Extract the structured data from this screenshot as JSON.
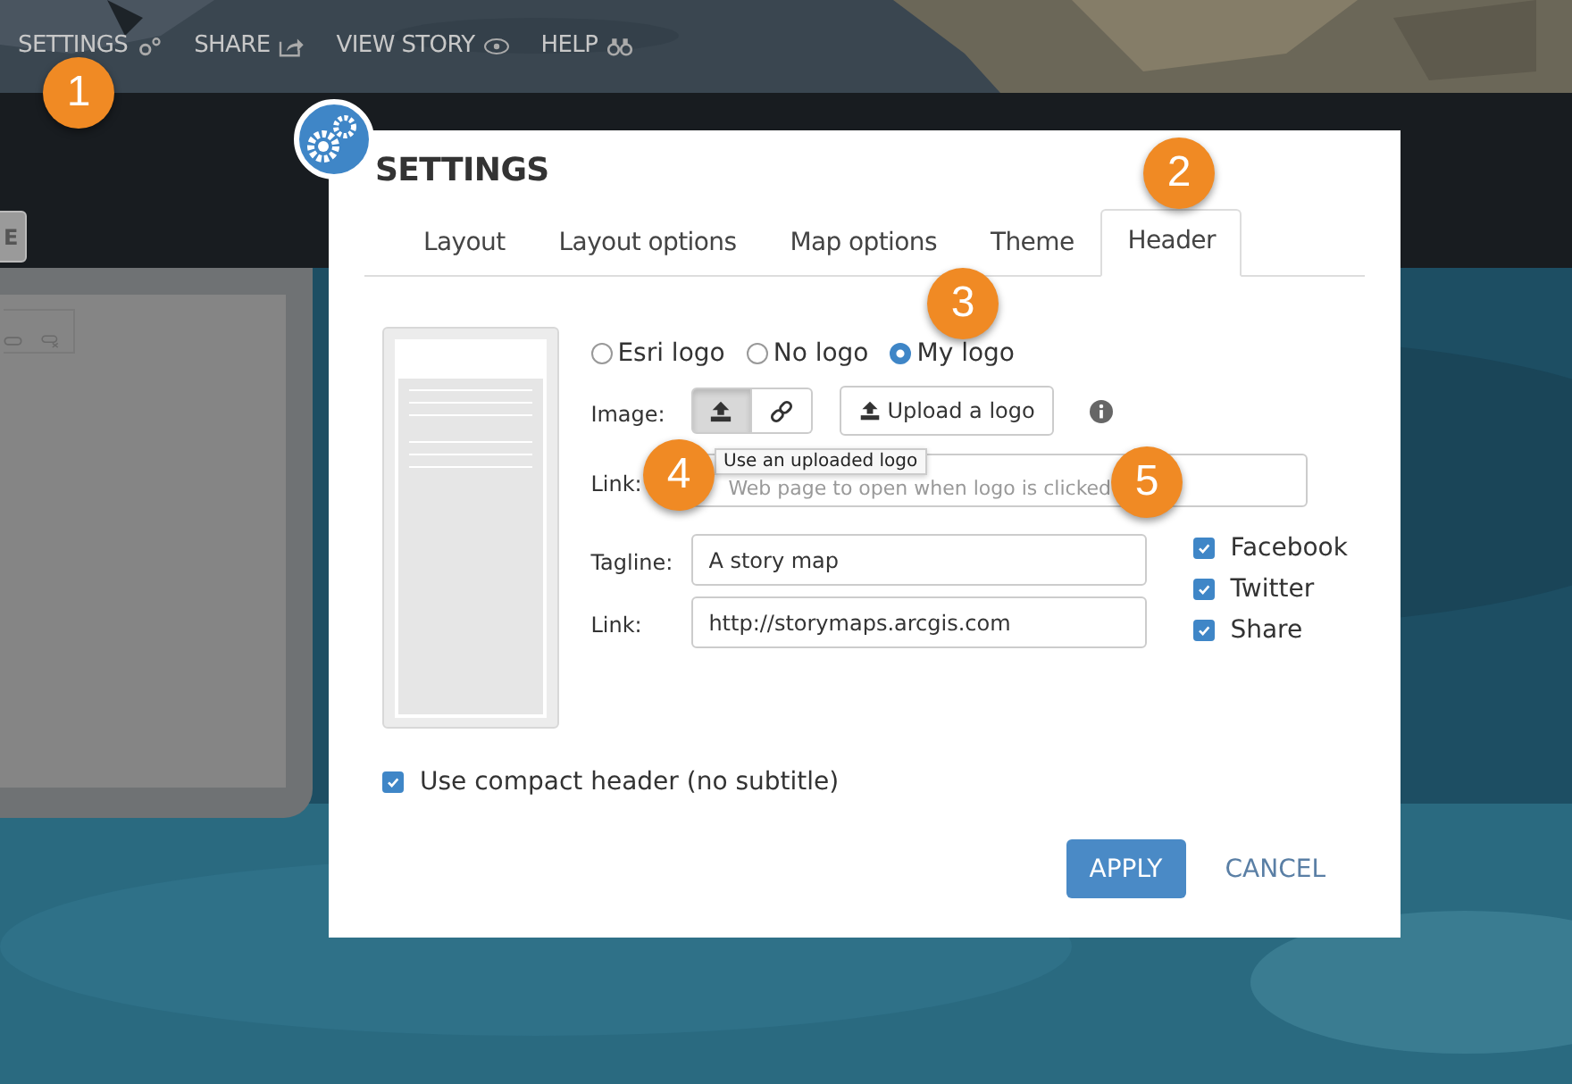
{
  "top_menu": [
    {
      "label": "SETTINGS",
      "kind": "settings"
    },
    {
      "label": "SHARE",
      "kind": "share"
    },
    {
      "label": "VIEW STORY",
      "kind": "view"
    },
    {
      "label": "HELP",
      "kind": "help"
    }
  ],
  "side_panel": {
    "button": "E"
  },
  "dialog": {
    "title": "SETTINGS",
    "tabs": [
      {
        "label": "Layout",
        "selected": false
      },
      {
        "label": "Layout options",
        "selected": false
      },
      {
        "label": "Map options",
        "selected": false
      },
      {
        "label": "Theme",
        "selected": false
      },
      {
        "label": "Header",
        "selected": true
      }
    ],
    "logo_options": [
      {
        "label": "Esri logo",
        "selected": false
      },
      {
        "label": "No logo",
        "selected": false
      },
      {
        "label": "My logo",
        "selected": true
      }
    ],
    "image": {
      "label": "Image:",
      "modes": [
        {
          "kind": "upload",
          "selected": true
        },
        {
          "kind": "link",
          "selected": false
        }
      ],
      "upload_button": "Upload a logo",
      "tooltip": "Use an uploaded logo"
    },
    "logo_link": {
      "label": "Link:",
      "placeholder": "Web page to open when logo is clicked"
    },
    "tagline": {
      "label": "Tagline:",
      "value": "A story map"
    },
    "tagline_link": {
      "label": "Link:",
      "value": "http://storymaps.arcgis.com"
    },
    "social": [
      {
        "label": "Facebook",
        "checked": true
      },
      {
        "label": "Twitter",
        "checked": true
      },
      {
        "label": "Share",
        "checked": true
      }
    ],
    "compact": {
      "label": "Use compact header (no subtitle)",
      "checked": true
    },
    "apply": "APPLY",
    "cancel": "CANCEL"
  },
  "callouts": [
    "1",
    "2",
    "3",
    "4",
    "5"
  ]
}
